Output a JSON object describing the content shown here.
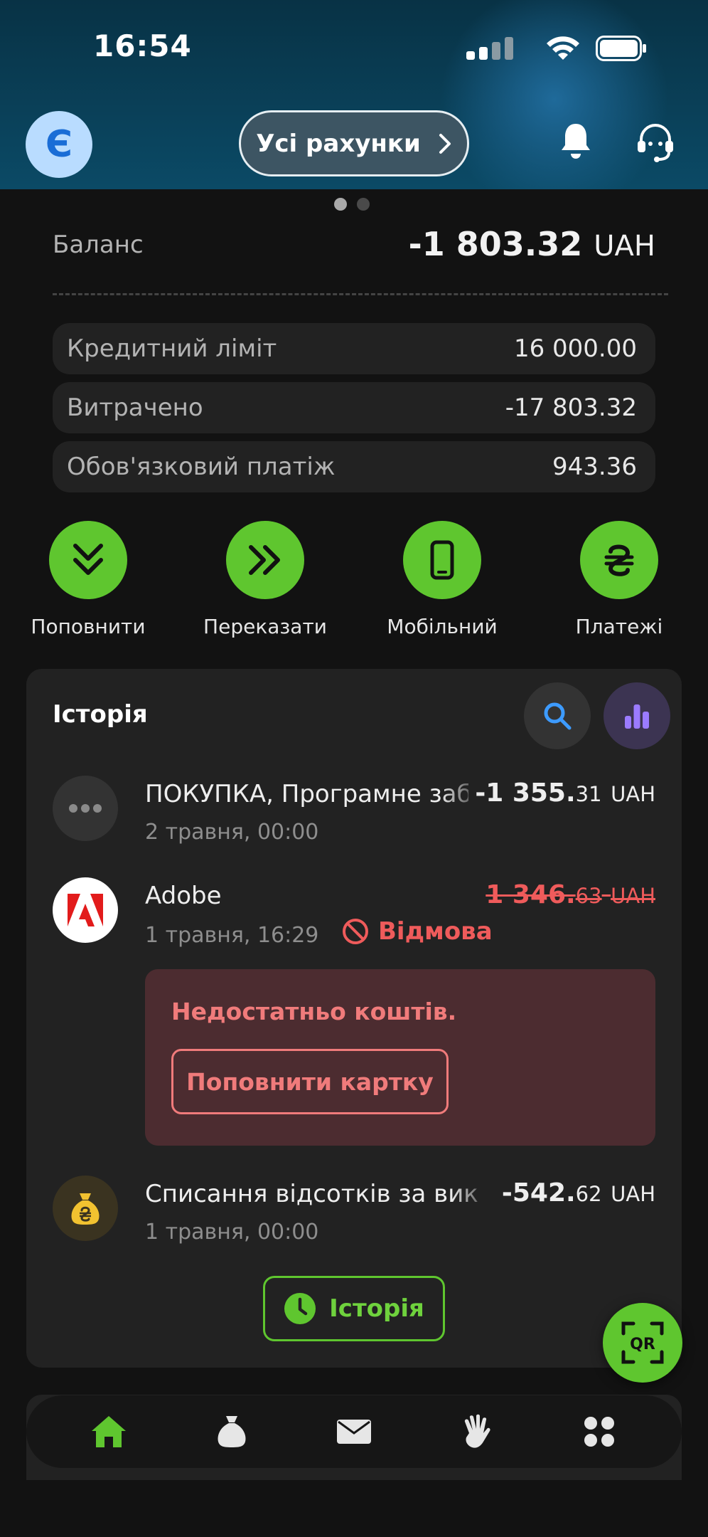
{
  "status_bar": {
    "time": "16:54"
  },
  "header": {
    "avatar_letter": "Є",
    "accounts_label": "Усі рахунки"
  },
  "balance": {
    "label": "Баланс",
    "value_main": "-1 803.32",
    "currency": "UAH"
  },
  "info_rows": [
    {
      "label": "Кредитний ліміт",
      "value": "16 000.00"
    },
    {
      "label": "Витрачено",
      "value": "-17 803.32"
    },
    {
      "label": "Обов'язковий платіж",
      "value": "943.36"
    }
  ],
  "actions": [
    {
      "label": "Поповнити",
      "icon": "double-chevron-down-icon"
    },
    {
      "label": "Переказати",
      "icon": "double-chevron-right-icon"
    },
    {
      "label": "Мобільний",
      "icon": "phone-icon"
    },
    {
      "label": "Платежі",
      "icon": "hryvnia-icon"
    }
  ],
  "history": {
    "title": "Історія",
    "transactions": [
      {
        "name": "ПОКУПКА, Програмне забезпечення",
        "amount_main": "-1 355.",
        "amount_cents": "31",
        "currency": "UAH",
        "date": "2 травня, 00:00",
        "icon": "more-dots-icon"
      },
      {
        "name": "Adobe",
        "amount_main": "1 346.",
        "amount_cents": "63",
        "currency": "UAH",
        "date": "1 травня, 16:29",
        "status": "Відмова",
        "icon": "adobe-logo-icon"
      },
      {
        "name": "Списання відсотків за використання",
        "amount_main": "-542.",
        "amount_cents": "62",
        "currency": "UAH",
        "date": "1 травня, 00:00",
        "icon": "money-bag-icon"
      }
    ],
    "alert": {
      "message": "Недостатньо коштів.",
      "button": "Поповнити картку"
    },
    "history_button": "Історія"
  },
  "qr_label": "QR",
  "colors": {
    "accent_green": "#5fc62f",
    "danger_red": "#ef5b5b",
    "background": "#121212",
    "card": "#222222"
  },
  "bottom_nav": [
    "home-icon",
    "savings-bag-icon",
    "envelope-icon",
    "hand-icon",
    "apps-grid-icon"
  ]
}
